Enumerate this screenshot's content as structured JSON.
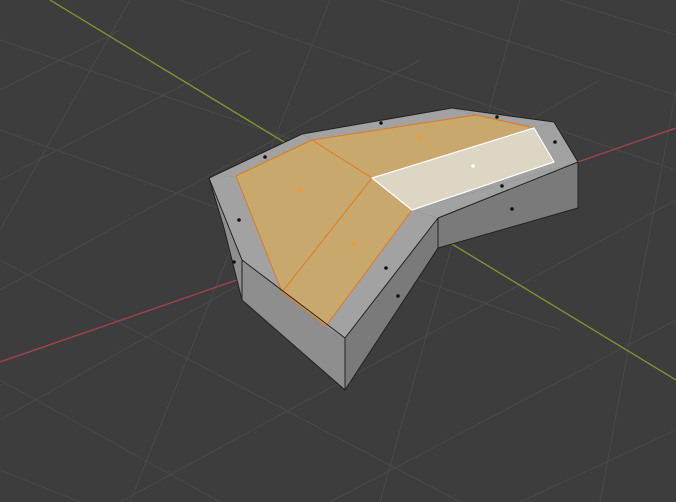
{
  "viewport": {
    "background_color": "#3d3d3d",
    "grid_color": "#4a4a4a",
    "x_axis_color": "#a8404a",
    "y_axis_color": "#7e9a2e"
  },
  "mesh": {
    "side_face_color": "#8e8e8e",
    "side_face_dark_color": "#7a7a7a",
    "rim_face_color": "#a2a2a2",
    "selected_face_color": "#c9a86e",
    "active_face_color": "#ddd6c4",
    "edge_color": "#222222",
    "selected_edge_color": "#e07a1a",
    "active_edge_color": "#ffffff",
    "vertex_color": "#111111",
    "selected_center_color": "#ff9a1a",
    "selected_faces": 3,
    "active_faces": 1
  }
}
